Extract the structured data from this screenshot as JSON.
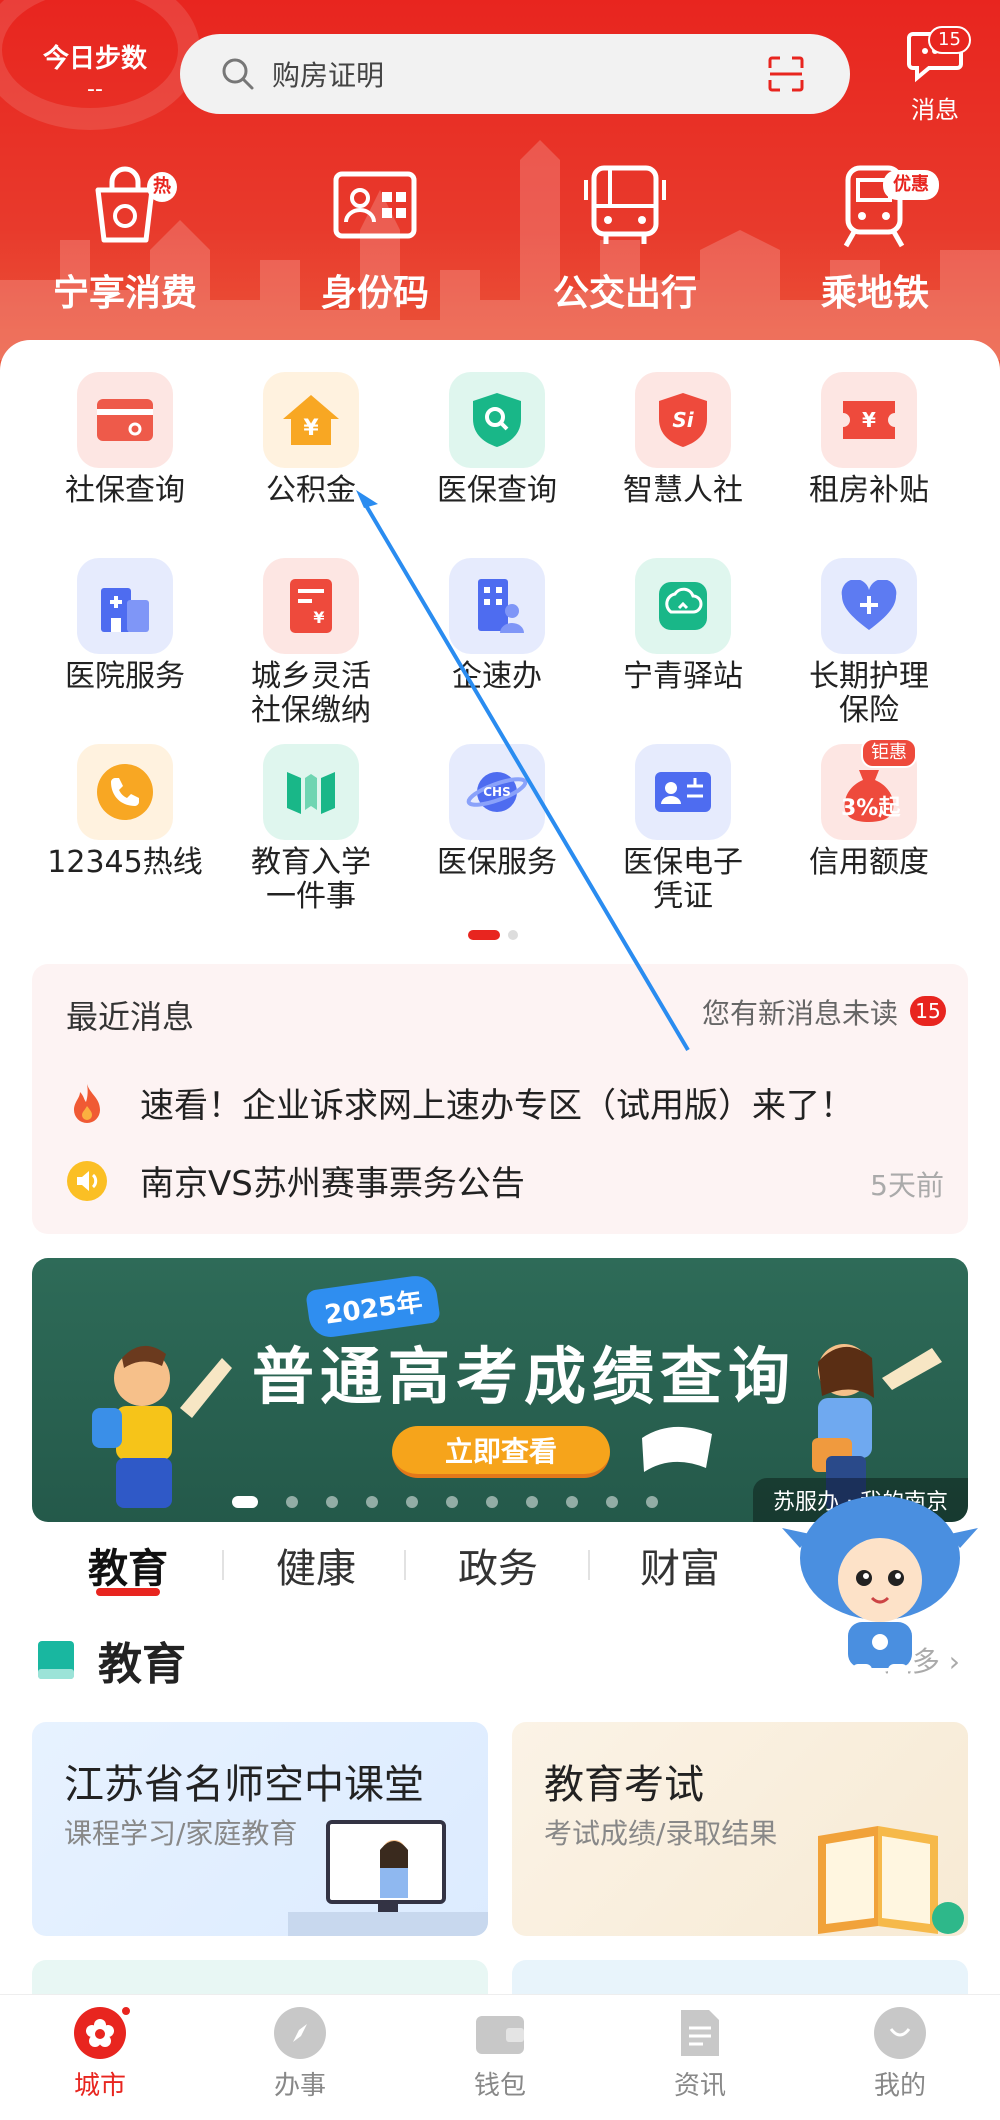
{
  "header": {
    "steps_label": "今日步数",
    "steps_value": "--",
    "search_placeholder": "购房证明",
    "message_label": "消息",
    "message_badge": "15"
  },
  "quick_actions": [
    {
      "label": "宁享消费",
      "badge": "热",
      "icon": "shopping-bag-icon"
    },
    {
      "label": "身份码",
      "icon": "id-card-icon"
    },
    {
      "label": "公交出行",
      "icon": "bus-icon"
    },
    {
      "label": "乘地铁",
      "badge": "优惠",
      "icon": "metro-icon"
    }
  ],
  "services": [
    {
      "label": "社保查询",
      "icon": "social-security-card-icon"
    },
    {
      "label": "公积金",
      "icon": "housing-fund-icon"
    },
    {
      "label": "医保查询",
      "icon": "medical-shield-icon"
    },
    {
      "label": "智慧人社",
      "icon": "smart-hr-icon"
    },
    {
      "label": "租房补贴",
      "icon": "rent-subsidy-icon"
    },
    {
      "label": "医院服务",
      "icon": "hospital-icon"
    },
    {
      "label": "城乡灵活\n社保缴纳",
      "icon": "payment-doc-icon"
    },
    {
      "label": "企速办",
      "icon": "enterprise-building-icon"
    },
    {
      "label": "宁青驿站",
      "icon": "youth-station-icon"
    },
    {
      "label": "长期护理\n保险",
      "icon": "care-heart-icon"
    },
    {
      "label": "12345热线",
      "icon": "phone-icon"
    },
    {
      "label": "教育入学\n一件事",
      "icon": "education-icon"
    },
    {
      "label": "医保服务",
      "icon": "chs-planet-icon"
    },
    {
      "label": "医保电子\n凭证",
      "icon": "medical-credential-icon"
    },
    {
      "label": "信用额度",
      "badge": "钜惠",
      "icon": "credit-bag-icon",
      "badge_text": "3%起"
    }
  ],
  "news": {
    "title": "最近消息",
    "unread_text": "您有新消息未读",
    "unread_count": "15",
    "items": [
      {
        "text": "速看！企业诉求网上速办专区（试用版）来了！",
        "icon": "fire-icon"
      },
      {
        "text": "南京VS苏州赛事票务公告",
        "icon": "speaker-icon",
        "time": "5天前"
      }
    ]
  },
  "banner": {
    "year": "2025年",
    "headline": "普通高考成绩查询",
    "button": "立即查看",
    "source": "苏服办 · 我的南京"
  },
  "tabs": [
    "教育",
    "健康",
    "政务",
    "财富"
  ],
  "section": {
    "title": "教育",
    "more": "更多"
  },
  "edu_cards": [
    {
      "title": "江苏省名师空中课堂",
      "subtitle": "课程学习/家庭教育"
    },
    {
      "title": "教育考试",
      "subtitle": "考试成绩/录取结果"
    }
  ],
  "bottom_nav": [
    {
      "label": "城市",
      "icon": "city-flower-icon",
      "active": true
    },
    {
      "label": "办事",
      "icon": "compass-icon"
    },
    {
      "label": "钱包",
      "icon": "wallet-icon"
    },
    {
      "label": "资讯",
      "icon": "news-doc-icon"
    },
    {
      "label": "我的",
      "icon": "profile-face-icon"
    }
  ],
  "colors": {
    "brand": "#e8251f",
    "banner_green": "#2e6b58",
    "accent_orange": "#f6a41b"
  }
}
